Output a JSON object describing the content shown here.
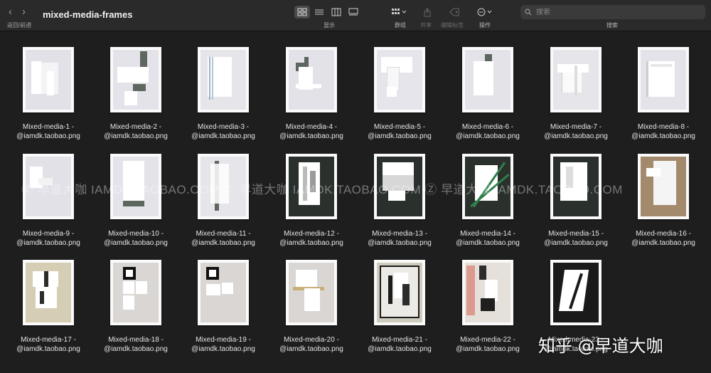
{
  "toolbar": {
    "back_icon": "chevron-left-icon",
    "forward_icon": "chevron-right-icon",
    "nav_label": "返回/前进",
    "title": "mixed-media-frames",
    "view_label": "显示",
    "group_label": "群组",
    "share_label": "共享",
    "tags_label": "编辑标签",
    "actions_label": "操作",
    "search_label": "搜索",
    "search_placeholder": "搜索"
  },
  "files": [
    {
      "line1": "Mixed-media-1 -",
      "line2": "@iamdk.taobao.png"
    },
    {
      "line1": "Mixed-media-2 -",
      "line2": "@iamdk.taobao.png"
    },
    {
      "line1": "Mixed-media-3 -",
      "line2": "@iamdk.taobao.png"
    },
    {
      "line1": "Mixed-media-4 -",
      "line2": "@iamdk.taobao.png"
    },
    {
      "line1": "Mixed-media-5 -",
      "line2": "@iamdk.taobao.png"
    },
    {
      "line1": "Mixed-media-6 -",
      "line2": "@iamdk.taobao.png"
    },
    {
      "line1": "Mixed-media-7 -",
      "line2": "@iamdk.taobao.png"
    },
    {
      "line1": "Mixed-media-8 -",
      "line2": "@iamdk.taobao.png"
    },
    {
      "line1": "Mixed-media-9 -",
      "line2": "@iamdk.taobao.png"
    },
    {
      "line1": "Mixed-media-10 -",
      "line2": "@iamdk.taobao.png"
    },
    {
      "line1": "Mixed-media-11 -",
      "line2": "@iamdk.taobao.png"
    },
    {
      "line1": "Mixed-media-12 -",
      "line2": "@iamdk.taobao.png"
    },
    {
      "line1": "Mixed-media-13 -",
      "line2": "@iamdk.taobao.png"
    },
    {
      "line1": "Mixed-media-14 -",
      "line2": "@iamdk.taobao.png"
    },
    {
      "line1": "Mixed-media-15 -",
      "line2": "@iamdk.taobao.png"
    },
    {
      "line1": "Mixed-media-16 -",
      "line2": "@iamdk.taobao.png"
    },
    {
      "line1": "Mixed-media-17 -",
      "line2": "@iamdk.taobao.png"
    },
    {
      "line1": "Mixed-media-18 -",
      "line2": "@iamdk.taobao.png"
    },
    {
      "line1": "Mixed-media-19 -",
      "line2": "@iamdk.taobao.png"
    },
    {
      "line1": "Mixed-media-20 -",
      "line2": "@iamdk.taobao.png"
    },
    {
      "line1": "Mixed-media-21 -",
      "line2": "@iamdk.taobao.png"
    },
    {
      "line1": "Mixed-media-22 -",
      "line2": "@iamdk.taobao.png"
    },
    {
      "line1": "Mixed-media-23 -",
      "line2": "@iamdk.taobao.png"
    }
  ],
  "watermark": "Ⓩ 早道大咖  IAMDK.TAOBAO.COM   Ⓩ 早道大咖  IAMDK.TAOBAO.COM   Ⓩ 早道大咖  IAMDK.TAOBAO.COM",
  "zhihu_watermark": "知乎 @早道大咖"
}
